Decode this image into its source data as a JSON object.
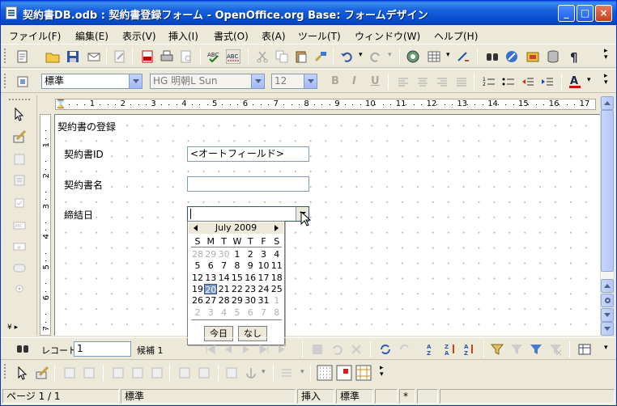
{
  "window": {
    "title": "契約書DB.odb : 契約書登録フォーム - OpenOffice.org Base: フォームデザイン",
    "minimize": "_",
    "maximize": "□",
    "close": "×"
  },
  "menu": {
    "items": [
      "ファイル(F)",
      "編集(E)",
      "表示(V)",
      "挿入(I)",
      "書式(O)",
      "表(A)",
      "ツール(T)",
      "ウィンドウ(W)",
      "ヘルプ(H)"
    ]
  },
  "formatting": {
    "style_value": "標準",
    "font_value": "HG 明朝L Sun",
    "size_value": "12",
    "bold": "B",
    "italic": "I",
    "underline": "U"
  },
  "ruler": {
    "numbers": [
      "1",
      "2",
      "3",
      "4",
      "5",
      "6",
      "7",
      "8",
      "9",
      "10",
      "11",
      "12",
      "13",
      "14",
      "15",
      "16",
      "17"
    ],
    "vnumbers": [
      "1",
      "2",
      "3",
      "4",
      "5",
      "6",
      "7"
    ]
  },
  "form": {
    "heading": "契約書の登録",
    "fields": [
      {
        "label": "契約書ID",
        "value": "<オートフィールド>"
      },
      {
        "label": "契約書名",
        "value": ""
      },
      {
        "label": "締結日",
        "value": ""
      }
    ]
  },
  "calendar": {
    "month_label": "July 2009",
    "dow": [
      "S",
      "M",
      "T",
      "W",
      "T",
      "F",
      "S"
    ],
    "weeks": [
      [
        "28",
        "29",
        "30",
        "1",
        "2",
        "3",
        "4"
      ],
      [
        "5",
        "6",
        "7",
        "8",
        "9",
        "10",
        "11"
      ],
      [
        "12",
        "13",
        "14",
        "15",
        "16",
        "17",
        "18"
      ],
      [
        "19",
        "20",
        "21",
        "22",
        "23",
        "24",
        "25"
      ],
      [
        "26",
        "27",
        "28",
        "29",
        "30",
        "31",
        "1"
      ],
      [
        "2",
        "3",
        "4",
        "5",
        "6",
        "7",
        "8"
      ]
    ],
    "selected_day": "20",
    "today_label": "今日",
    "none_label": "なし"
  },
  "navbar": {
    "record_label": "レコード",
    "record_value": "1",
    "candidate_label": "候補 1"
  },
  "status": {
    "page": "ページ 1 / 1",
    "style": "標準",
    "insert_mode": "挿入",
    "selection_mode": "標準",
    "modified": "*"
  },
  "colors": {
    "titlebar": "#0548c7",
    "selected_day": "#7a96c8",
    "chrome": "#ece9d8"
  }
}
